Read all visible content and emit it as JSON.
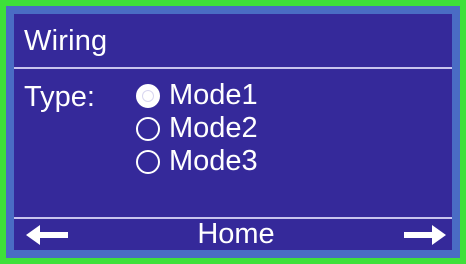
{
  "screen": {
    "title": "Wiring",
    "type_label": "Type:",
    "options": [
      {
        "label": "Mode1",
        "selected": true
      },
      {
        "label": "Mode2",
        "selected": false
      },
      {
        "label": "Mode3",
        "selected": false
      }
    ]
  },
  "footer": {
    "back_icon": "left-arrow-icon",
    "home_label": "Home",
    "forward_icon": "right-arrow-icon"
  },
  "colors": {
    "frame": "#3ee03a",
    "bezel": "#4a6cc4",
    "screen_bg": "#35299a",
    "text": "#ffffff"
  }
}
